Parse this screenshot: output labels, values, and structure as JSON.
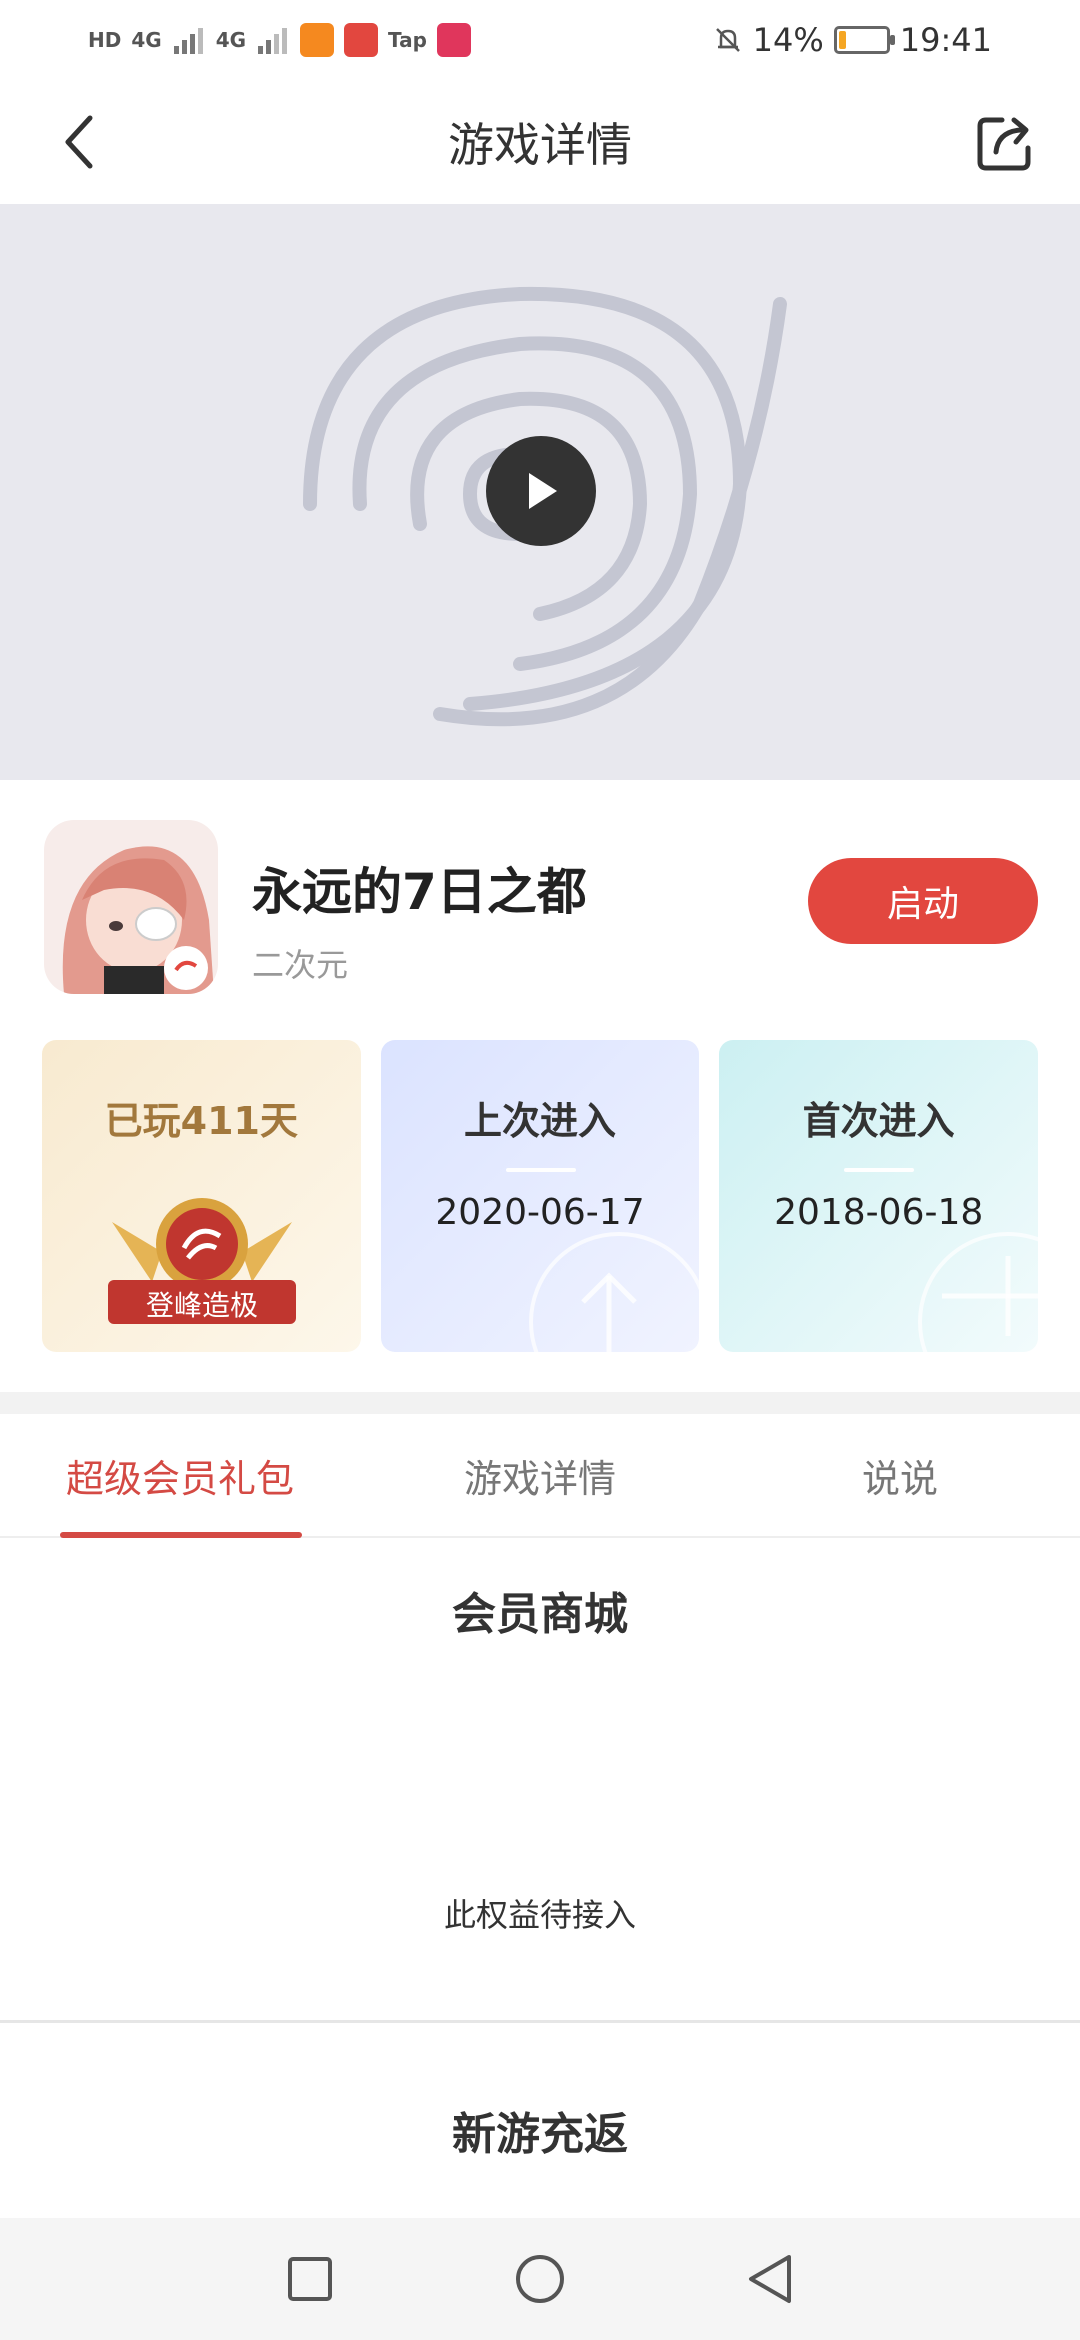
{
  "status_bar": {
    "hd_label": "HD",
    "sim1": "4G",
    "sim2": "4G",
    "app_tap_label": "Tap",
    "battery_percent": "14%",
    "battery_level": 0.14,
    "time": "19:41"
  },
  "header": {
    "title": "游戏详情"
  },
  "game": {
    "name": "永远的7日之都",
    "category": "二次元",
    "launch_label": "启动"
  },
  "stats": {
    "played": {
      "label": "已玩411天",
      "badge_text": "登峰造极"
    },
    "last_enter": {
      "label": "上次进入",
      "value": "2020-06-17"
    },
    "first_enter": {
      "label": "首次进入",
      "value": "2018-06-18"
    }
  },
  "tabs": [
    {
      "label": "超级会员礼包",
      "active": true
    },
    {
      "label": "游戏详情",
      "active": false
    },
    {
      "label": "说说",
      "active": false
    }
  ],
  "sections": {
    "member_mall_title": "会员商城",
    "member_mall_empty": "此权益待接入",
    "new_game_title": "新游充返"
  },
  "colors": {
    "accent": "#e2473f",
    "tab_active": "#d44a44",
    "banner_bg": "#e8e8ee"
  }
}
